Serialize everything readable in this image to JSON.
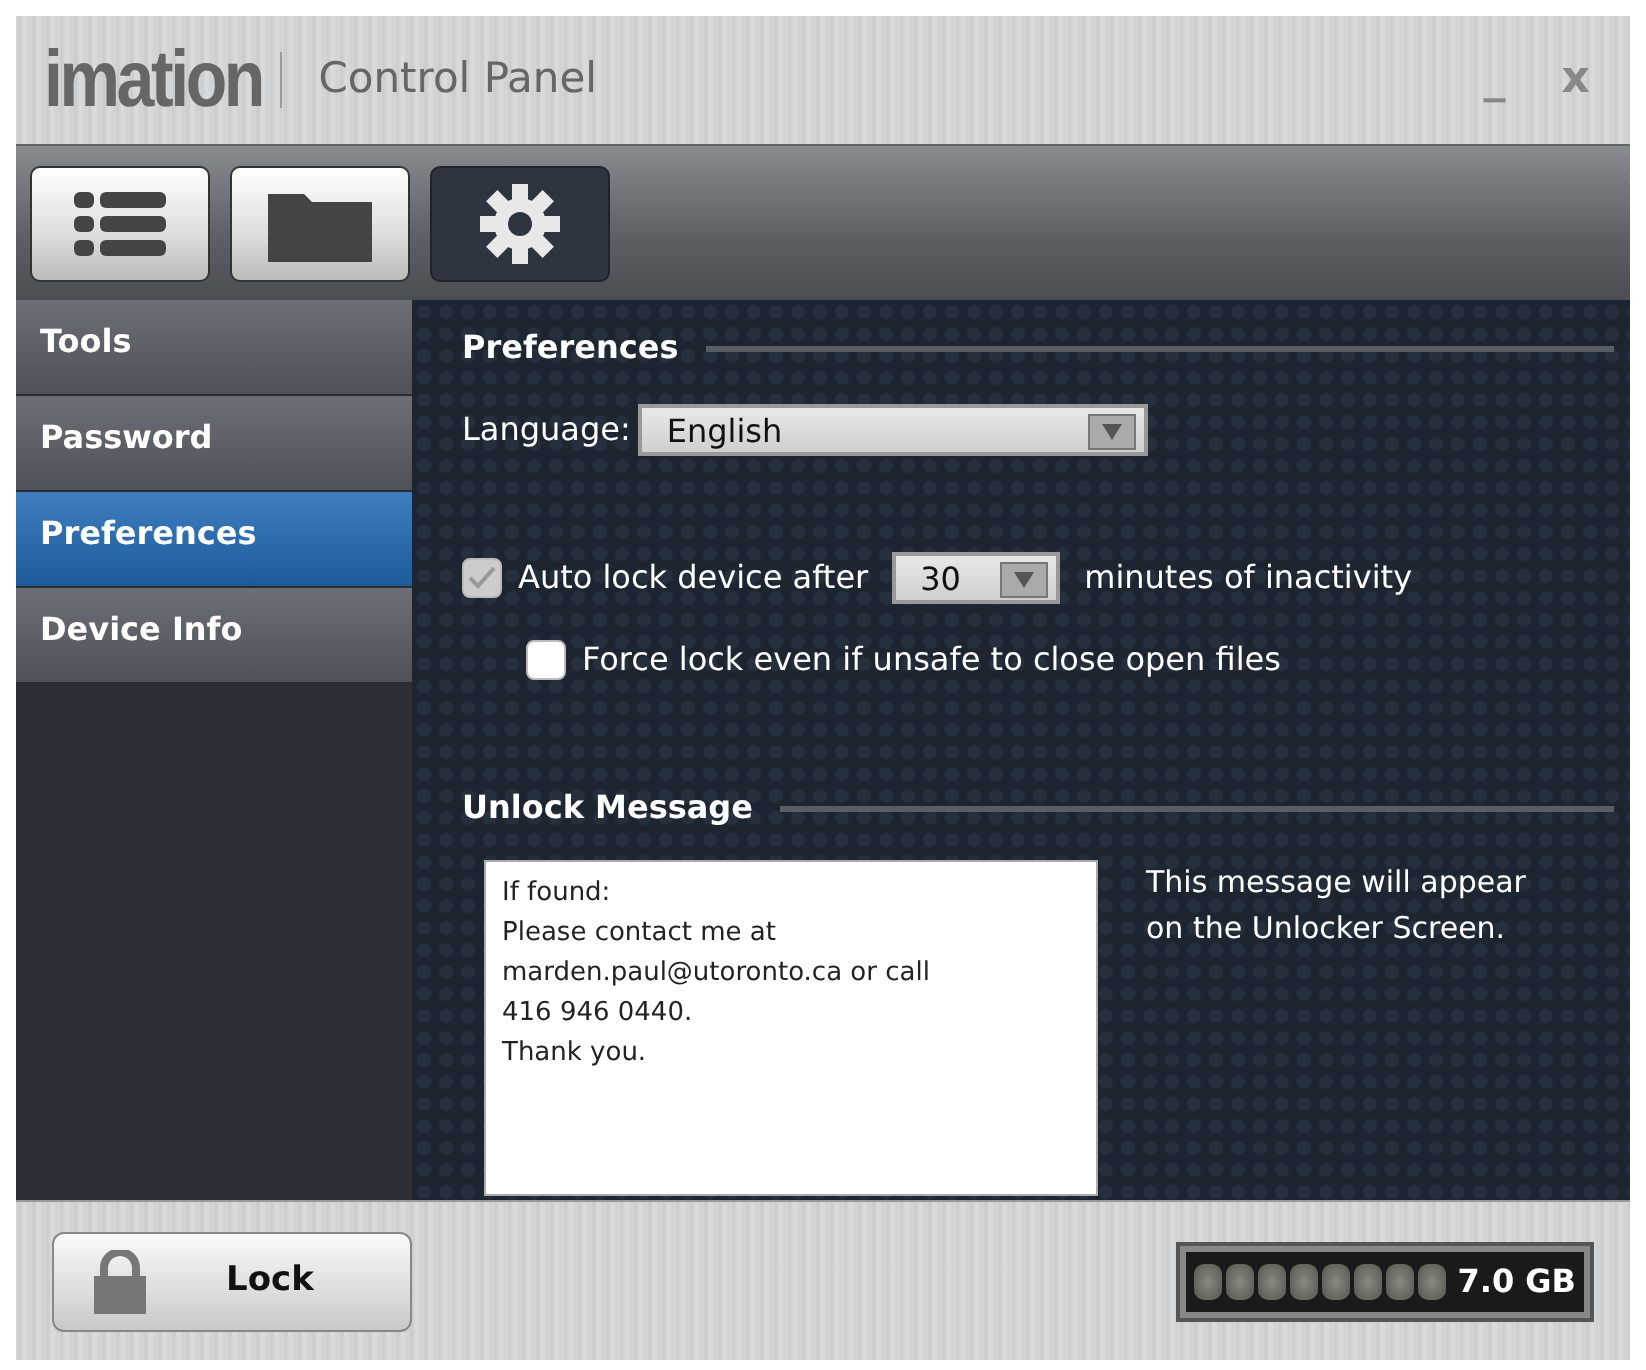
{
  "window": {
    "logo": "imation",
    "title": "Control Panel",
    "minimize": "_",
    "close": "x"
  },
  "toolbar": [
    {
      "kind": "list",
      "selected": false
    },
    {
      "kind": "folder",
      "selected": false
    },
    {
      "kind": "gear",
      "selected": true
    }
  ],
  "sidebar": {
    "items": [
      {
        "label": "Tools",
        "selected": false
      },
      {
        "label": "Password",
        "selected": false
      },
      {
        "label": "Preferences",
        "selected": true
      },
      {
        "label": "Device Info",
        "selected": false
      }
    ]
  },
  "preferences": {
    "heading": "Preferences",
    "language_label": "Language:",
    "language": "English",
    "auto_lock": {
      "label": "Auto lock device after",
      "checked": true,
      "disabled": true,
      "minutes": "30",
      "suffix": "minutes of inactivity"
    },
    "force_lock": {
      "label": "Force lock even if unsafe to close open files",
      "checked": false
    }
  },
  "unlock_message": {
    "heading": "Unlock Message",
    "value": "If found:\nPlease contact me at\nmarden.paul@utoronto.ca or call\n416 946 0440.\nThank you.",
    "hint": "This message will appear on the Unlocker Screen."
  },
  "footer": {
    "lock_button": "Lock",
    "capacity": "7.0 GB"
  }
}
